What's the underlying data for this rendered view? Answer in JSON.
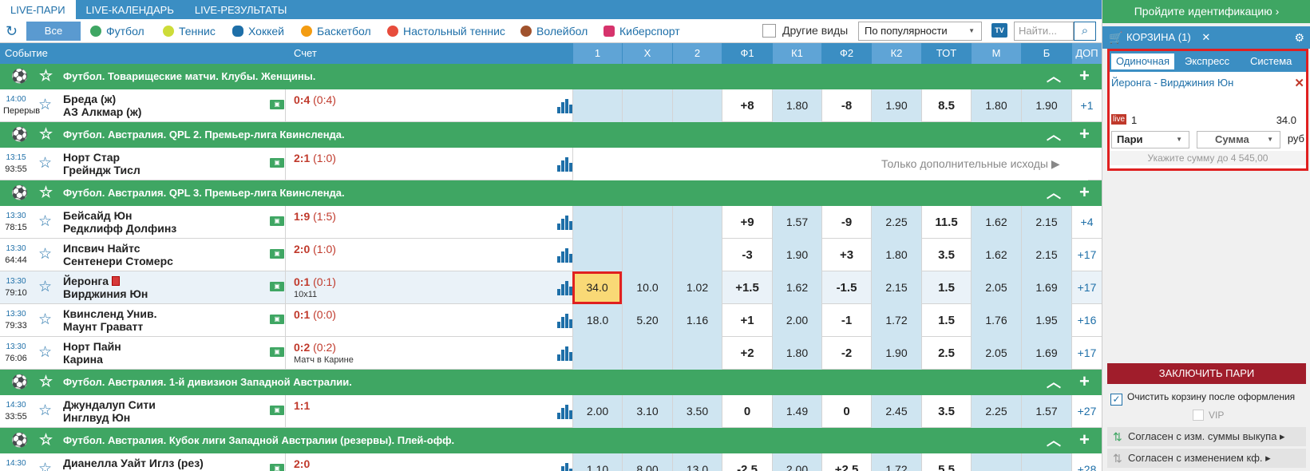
{
  "topnav": {
    "tabs": [
      "LIVE-ПАРИ",
      "LIVE-КАЛЕНДАРЬ",
      "LIVE-РЕЗУЛЬТАТЫ"
    ]
  },
  "sportbar": {
    "all_label": "Все",
    "sports": [
      {
        "label": "Футбол",
        "icon": "football-icon"
      },
      {
        "label": "Теннис",
        "icon": "tennis-icon"
      },
      {
        "label": "Хоккей",
        "icon": "hockey-icon"
      },
      {
        "label": "Баскетбол",
        "icon": "basketball-icon"
      },
      {
        "label": "Настольный теннис",
        "icon": "table-tennis-icon"
      },
      {
        "label": "Волейбол",
        "icon": "volleyball-icon"
      },
      {
        "label": "Киберспорт",
        "icon": "gamepad-icon"
      }
    ],
    "other_label": "Другие виды",
    "sort_value": "По популярности",
    "search_placeholder": "Найти..."
  },
  "header": {
    "event": "Событие",
    "score": "Счет",
    "cols": [
      "1",
      "X",
      "2",
      "Ф1",
      "К1",
      "Ф2",
      "К2",
      "ТОТ",
      "М",
      "Б",
      "ДОП"
    ]
  },
  "groups": [
    "Футбол. Товарищеские матчи. Клубы. Женщины.",
    "Футбол. Австралия. QPL 2. Премьер-лига Квинсленда.",
    "Футбол. Австралия. QPL 3. Премьер-лига Квинсленда.",
    "Футбол. Австралия. 1-й дивизион Западной Австралии.",
    "Футбол. Австралия. Кубок лиги Западной Австралии (резервы). Плей-офф."
  ],
  "matches": [
    {
      "time": "14:00",
      "clock": "Перерыв",
      "team1": "Бреда (ж)",
      "team2": "АЗ Алкмар (ж)",
      "score": "0:4",
      "half": "(0:4)",
      "note": "",
      "odds": [
        "",
        "",
        "",
        "+8",
        "1.80",
        "-8",
        "1.90",
        "8.5",
        "1.80",
        "1.90",
        "+1"
      ]
    },
    {
      "time": "13:15",
      "clock": "93:55",
      "team1": "Норт Стар",
      "team2": "Грейндж Тисл",
      "score": "2:1",
      "half": "(1:0)",
      "note": "",
      "only_extra": "Только дополнительные исходы ▶"
    },
    {
      "time": "13:30",
      "clock": "78:15",
      "team1": "Бейсайд Юн",
      "team2": "Редклифф Долфинз",
      "score": "1:9",
      "half": "(1:5)",
      "note": "",
      "odds": [
        "",
        "",
        "",
        "+9",
        "1.57",
        "-9",
        "2.25",
        "11.5",
        "1.62",
        "2.15",
        "+4"
      ]
    },
    {
      "time": "13:30",
      "clock": "64:44",
      "team1": "Ипсвич Найтс",
      "team2": "Сентенери Стомерс",
      "score": "2:0",
      "half": "(1:0)",
      "note": "",
      "odds": [
        "",
        "",
        "",
        "-3",
        "1.90",
        "+3",
        "1.80",
        "3.5",
        "1.62",
        "2.15",
        "+17"
      ]
    },
    {
      "time": "13:30",
      "clock": "79:10",
      "team1": "Йеронга",
      "team2": "Вирджиния Юн",
      "score": "0:1",
      "half": "(0:1)",
      "note": "10x11",
      "odds": [
        "34.0",
        "10.0",
        "1.02",
        "+1.5",
        "1.62",
        "-1.5",
        "2.15",
        "1.5",
        "2.05",
        "1.69",
        "+17"
      ]
    },
    {
      "time": "13:30",
      "clock": "79:33",
      "team1": "Квинсленд Унив.",
      "team2": "Маунт Граватт",
      "score": "0:1",
      "half": "(0:0)",
      "note": "",
      "odds": [
        "18.0",
        "5.20",
        "1.16",
        "+1",
        "2.00",
        "-1",
        "1.72",
        "1.5",
        "1.76",
        "1.95",
        "+16"
      ]
    },
    {
      "time": "13:30",
      "clock": "76:06",
      "team1": "Норт Пайн",
      "team2": "Карина",
      "score": "0:2",
      "half": "(0:2)",
      "note": "Матч в Карине",
      "odds": [
        "",
        "",
        "",
        "+2",
        "1.80",
        "-2",
        "1.90",
        "2.5",
        "2.05",
        "1.69",
        "+17"
      ]
    },
    {
      "time": "14:30",
      "clock": "33:55",
      "team1": "Джундалуп Сити",
      "team2": "Инглвуд Юн",
      "score": "1:1",
      "half": "",
      "note": "",
      "odds": [
        "2.00",
        "3.10",
        "3.50",
        "0",
        "1.49",
        "0",
        "2.45",
        "3.5",
        "2.25",
        "1.57",
        "+27"
      ]
    },
    {
      "time": "14:30",
      "clock": "",
      "team1": "Дианелла Уайт Иглз (рез)",
      "team2": "",
      "score": "2:0",
      "half": "",
      "note": "",
      "odds": [
        "1.10",
        "8.00",
        "13.0",
        "-2.5",
        "2.00",
        "+2.5",
        "1.72",
        "5.5",
        "",
        "",
        "+28"
      ]
    }
  ],
  "sidebar": {
    "identify": "Пройдите идентификацию",
    "cart_title": "КОРЗИНА (1)",
    "bet_tabs": [
      "Одиночная",
      "Экспресс",
      "Система"
    ],
    "bet_event": "Йеронга - Вирджиния Юн",
    "bet_live": "live",
    "bet_outcome": "1",
    "bet_odd": "34.0",
    "bet_type": "Пари",
    "bet_amount": "Сумма",
    "currency": "руб",
    "hint": "Укажите сумму до 4 545,00",
    "place_button": "ЗАКЛЮЧИТЬ ПАРИ",
    "clear_label": "Очистить корзину после оформления",
    "vip_label": "VIP",
    "agree1": "Согласен с изм. суммы выкупа ▸",
    "agree2": "Согласен с изменением кф. ▸"
  },
  "colors": {
    "blue": "#3b8ec3",
    "green": "#3fa663",
    "red": "#e02020",
    "dark_red": "#a01d2b",
    "selected": "#f9d976"
  }
}
